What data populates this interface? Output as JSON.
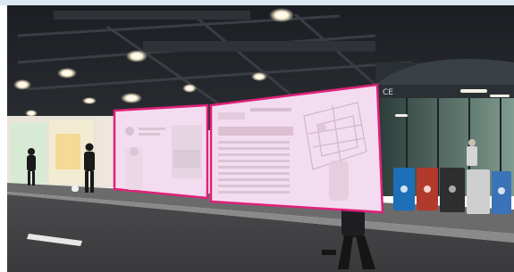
{
  "scene": {
    "description_free": true,
    "highlight_color": "#e0207a",
    "highlight_fill": "#f3dcef",
    "panel_left": {
      "lines": [
        "",
        "",
        ""
      ]
    },
    "panel_right": {
      "heading": "",
      "rows": [
        "",
        "",
        "",
        "",
        "",
        "",
        "",
        "",
        "",
        ""
      ]
    },
    "station_sign": "CE",
    "bins": [
      {
        "color": "#1d6fb8"
      },
      {
        "color": "#b23a2c"
      },
      {
        "color": "#2e2e2e"
      },
      {
        "color": "#cfcfcf"
      },
      {
        "color": "#3b73b8"
      }
    ]
  }
}
